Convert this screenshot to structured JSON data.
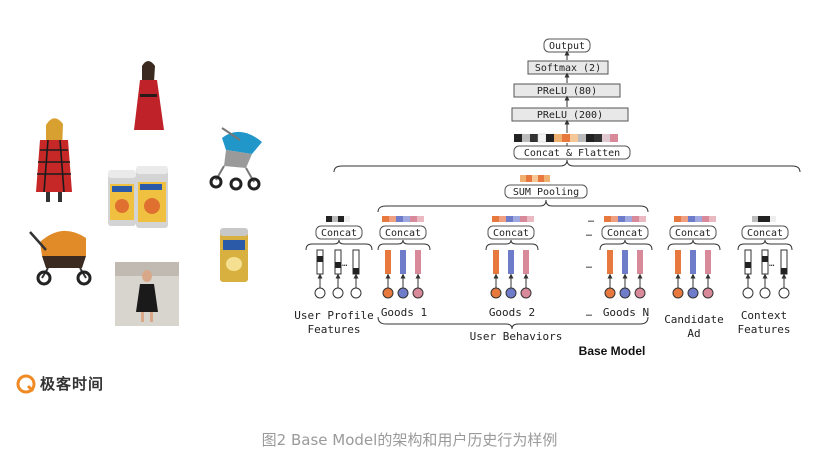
{
  "figure": {
    "caption": "图2 Base Model的架构和用户历史行为样例",
    "logo_text": "极客时间",
    "title": "Base Model"
  },
  "diagram": {
    "layers": {
      "output": "Output",
      "softmax": "Softmax (2)",
      "prelu80": "PReLU (80)",
      "prelu200": "PReLU (200)",
      "concat_flatten": "Concat & Flatten",
      "sum_pooling": "SUM Pooling"
    },
    "concat_label": "Concat",
    "ellipsis": "…",
    "groups": {
      "user_profile": [
        "User Profile",
        "Features"
      ],
      "goods1": "Goods 1",
      "goods2": "Goods 2",
      "goodsn": "Goods N",
      "candidate": [
        "Candidate",
        "Ad"
      ],
      "context": [
        "Context",
        "Features"
      ],
      "user_behaviors": "User Behaviors"
    }
  },
  "colors": {
    "accent_orange": "#e7793f",
    "accent_blue": "#6f7cc9",
    "accent_pink": "#d98a9a",
    "layer_box": "#e8e8e8",
    "caption": "#9a9a9a"
  },
  "images": [
    "woman-in-red-coat",
    "woman-in-red-dress",
    "baby-stroller-blue",
    "baby-stroller-orange",
    "milk-powder-cans",
    "milk-powder-can-gold",
    "woman-in-black-dress"
  ]
}
